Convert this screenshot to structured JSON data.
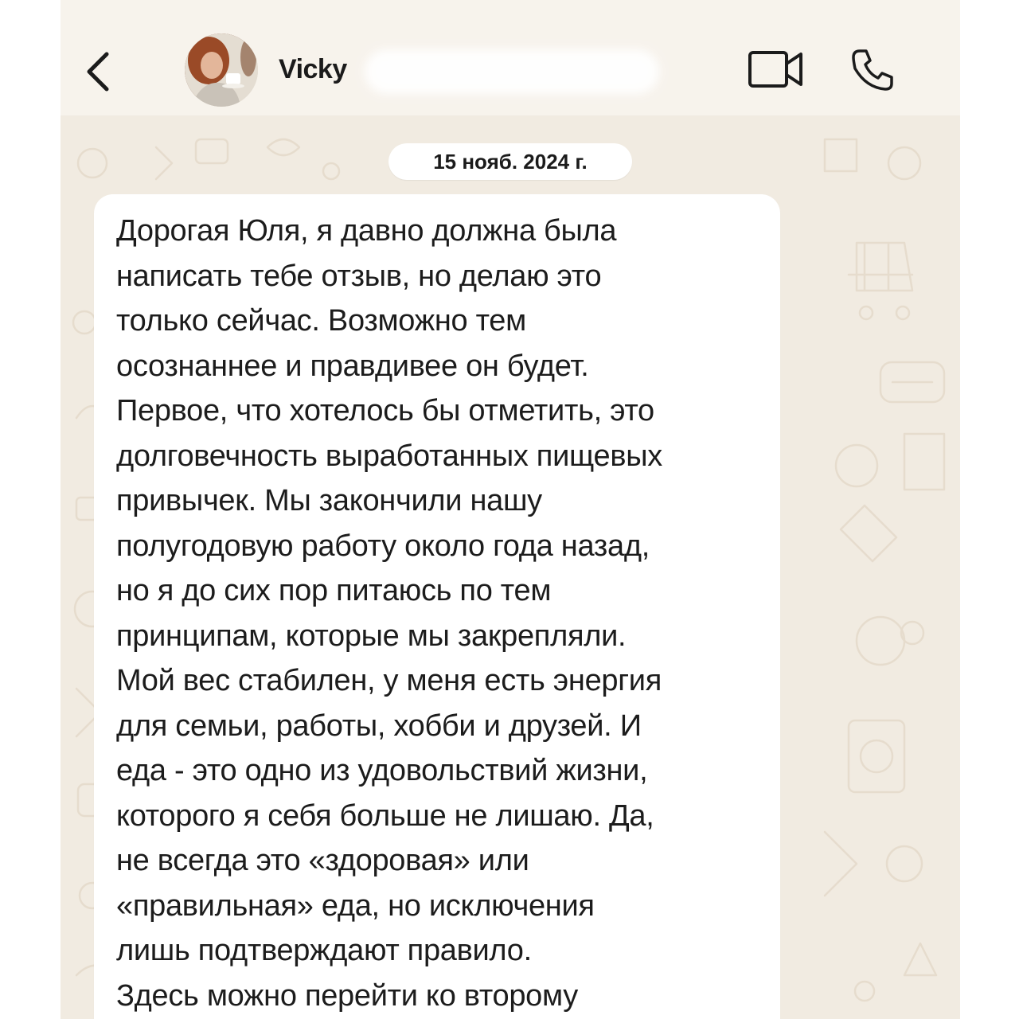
{
  "header": {
    "contact_name": "Vicky",
    "avatar": "profile-photo",
    "back_icon": "chevron-left-icon",
    "video_icon": "video-camera-icon",
    "call_icon": "phone-icon"
  },
  "chat": {
    "date_separator": "15 нояб. 2024 г.",
    "message": {
      "lines": [
        "Дорогая Юля, я давно должна была",
        "написать тебе отзыв, но делаю это",
        "только сейчас. Возможно тем",
        "осознаннее и правдивее он будет.",
        "Первое, что хотелось бы отметить, это",
        "долговечность выработанных пищевых",
        "привычек. Мы закончили нашу",
        "полугодовую работу около года назад,",
        "но я до сих пор питаюсь по тем",
        "принципам, которые мы закрепляли.",
        "Мой вес стабилен, у меня есть энергия",
        "для семьи, работы, хобби и друзей. И",
        "еда - это одно из удовольствий жизни,",
        "которого я себя больше не лишаю. Да,",
        "не всегда это «здоровая» или",
        "«правильная» еда, но исключения",
        "лишь подтверждают правило.",
        "Здесь можно перейти ко второму"
      ]
    }
  },
  "colors": {
    "chat_background": "#f1ebe1",
    "header_background": "#f7f3ec",
    "bubble": "#ffffff",
    "text": "#1c1c1c"
  }
}
